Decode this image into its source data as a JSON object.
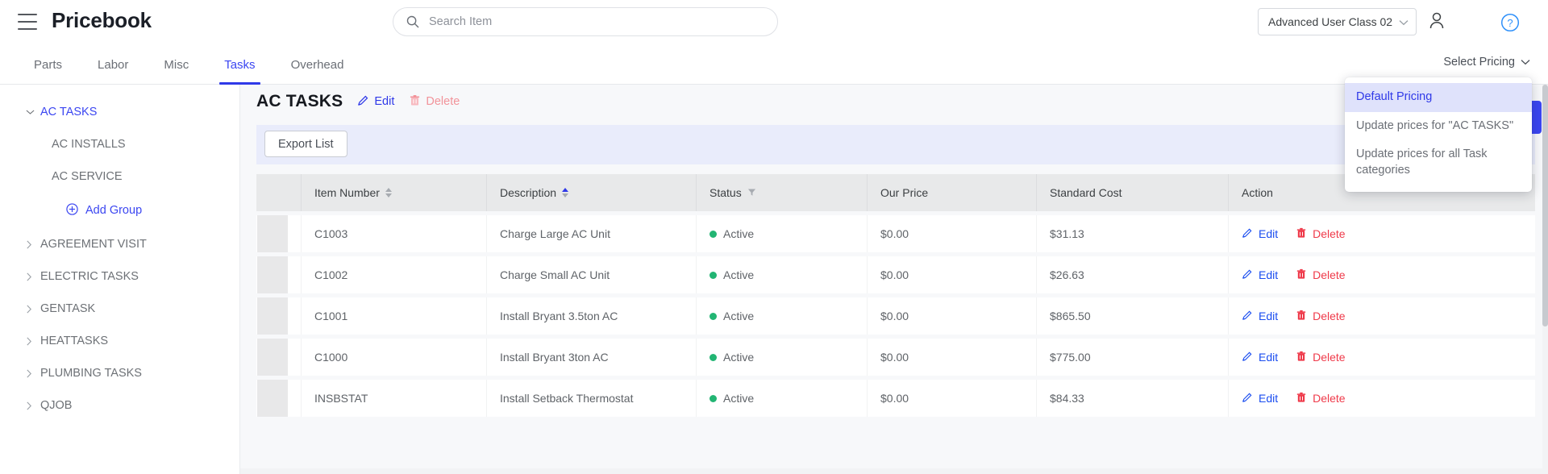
{
  "header": {
    "app_title": "Pricebook",
    "menu_icon": "hamburger-icon",
    "search": {
      "placeholder": "Search Item",
      "value": "",
      "icon": "search-icon"
    },
    "user_class": {
      "label": "Advanced User Class 02",
      "chevron": "chevron-down-icon"
    },
    "profile_icon": "person-icon",
    "help_icon": "help-circle-icon"
  },
  "tabs": [
    {
      "label": "Parts",
      "active": false
    },
    {
      "label": "Labor",
      "active": false
    },
    {
      "label": "Misc",
      "active": false
    },
    {
      "label": "Tasks",
      "active": true
    },
    {
      "label": "Overhead",
      "active": false
    }
  ],
  "select_pricing": {
    "label": "Select Pricing",
    "chevron": "chevron-down-icon"
  },
  "pricing_menu": {
    "items": [
      {
        "label": "Default Pricing",
        "selected": true
      },
      {
        "label": "Update prices for \"AC TASKS\"",
        "selected": false
      },
      {
        "label": "Update prices for all Task categories",
        "selected": false
      }
    ]
  },
  "sidebar": {
    "groups": [
      {
        "label": "AC TASKS",
        "expanded": true,
        "caret": "chevron-down-icon",
        "children": [
          "AC INSTALLS",
          "AC SERVICE"
        ],
        "add_group": {
          "label": "Add Group",
          "icon": "plus-circle-icon"
        }
      },
      {
        "label": "AGREEMENT VISIT",
        "expanded": false,
        "caret": "chevron-right-icon",
        "children": []
      },
      {
        "label": "ELECTRIC TASKS",
        "expanded": false,
        "caret": "chevron-right-icon",
        "children": []
      },
      {
        "label": "GENTASK",
        "expanded": false,
        "caret": "chevron-right-icon",
        "children": []
      },
      {
        "label": "HEATTASKS",
        "expanded": false,
        "caret": "chevron-right-icon",
        "children": []
      },
      {
        "label": "PLUMBING TASKS",
        "expanded": false,
        "caret": "chevron-right-icon",
        "children": []
      },
      {
        "label": "QJOB",
        "expanded": false,
        "caret": "chevron-right-icon",
        "children": []
      }
    ]
  },
  "main": {
    "category_title": "AC TASKS",
    "edit_label": "Edit",
    "delete_label": "Delete",
    "edit_icon": "pencil-icon",
    "delete_icon": "trash-icon",
    "export_label": "Export List"
  },
  "table": {
    "columns": [
      {
        "label": "",
        "sort": "none",
        "filter": false
      },
      {
        "label": "Item Number",
        "sort": "none",
        "filter": false
      },
      {
        "label": "Description",
        "sort": "asc",
        "filter": false
      },
      {
        "label": "Status",
        "sort": "none",
        "filter": true
      },
      {
        "label": "Our Price",
        "sort": "none",
        "filter": false
      },
      {
        "label": "Standard Cost",
        "sort": "none",
        "filter": false
      },
      {
        "label": "Action",
        "sort": "none",
        "filter": false
      }
    ],
    "row_action_edit": "Edit",
    "row_action_delete": "Delete",
    "rows": [
      {
        "item_number": "C1003",
        "description": "Charge Large AC Unit",
        "status": "Active",
        "our_price": "$0.00",
        "standard_cost": "$31.13"
      },
      {
        "item_number": "C1002",
        "description": "Charge Small AC Unit",
        "status": "Active",
        "our_price": "$0.00",
        "standard_cost": "$26.63"
      },
      {
        "item_number": "C1001",
        "description": "Install Bryant 3.5ton AC",
        "status": "Active",
        "our_price": "$0.00",
        "standard_cost": "$865.50"
      },
      {
        "item_number": "C1000",
        "description": "Install Bryant 3ton AC",
        "status": "Active",
        "our_price": "$0.00",
        "standard_cost": "$775.00"
      },
      {
        "item_number": "INSBSTAT",
        "description": "Install Setback Thermostat",
        "status": "Active",
        "our_price": "$0.00",
        "standard_cost": "$84.33"
      }
    ]
  },
  "colors": {
    "accent_blue": "#3b46f1",
    "link_blue": "#1a4df0",
    "danger_red": "#ef3a4a",
    "danger_red_dim": "#f2939a",
    "status_green": "#22b573",
    "band_lavender": "#e9ecfb"
  }
}
